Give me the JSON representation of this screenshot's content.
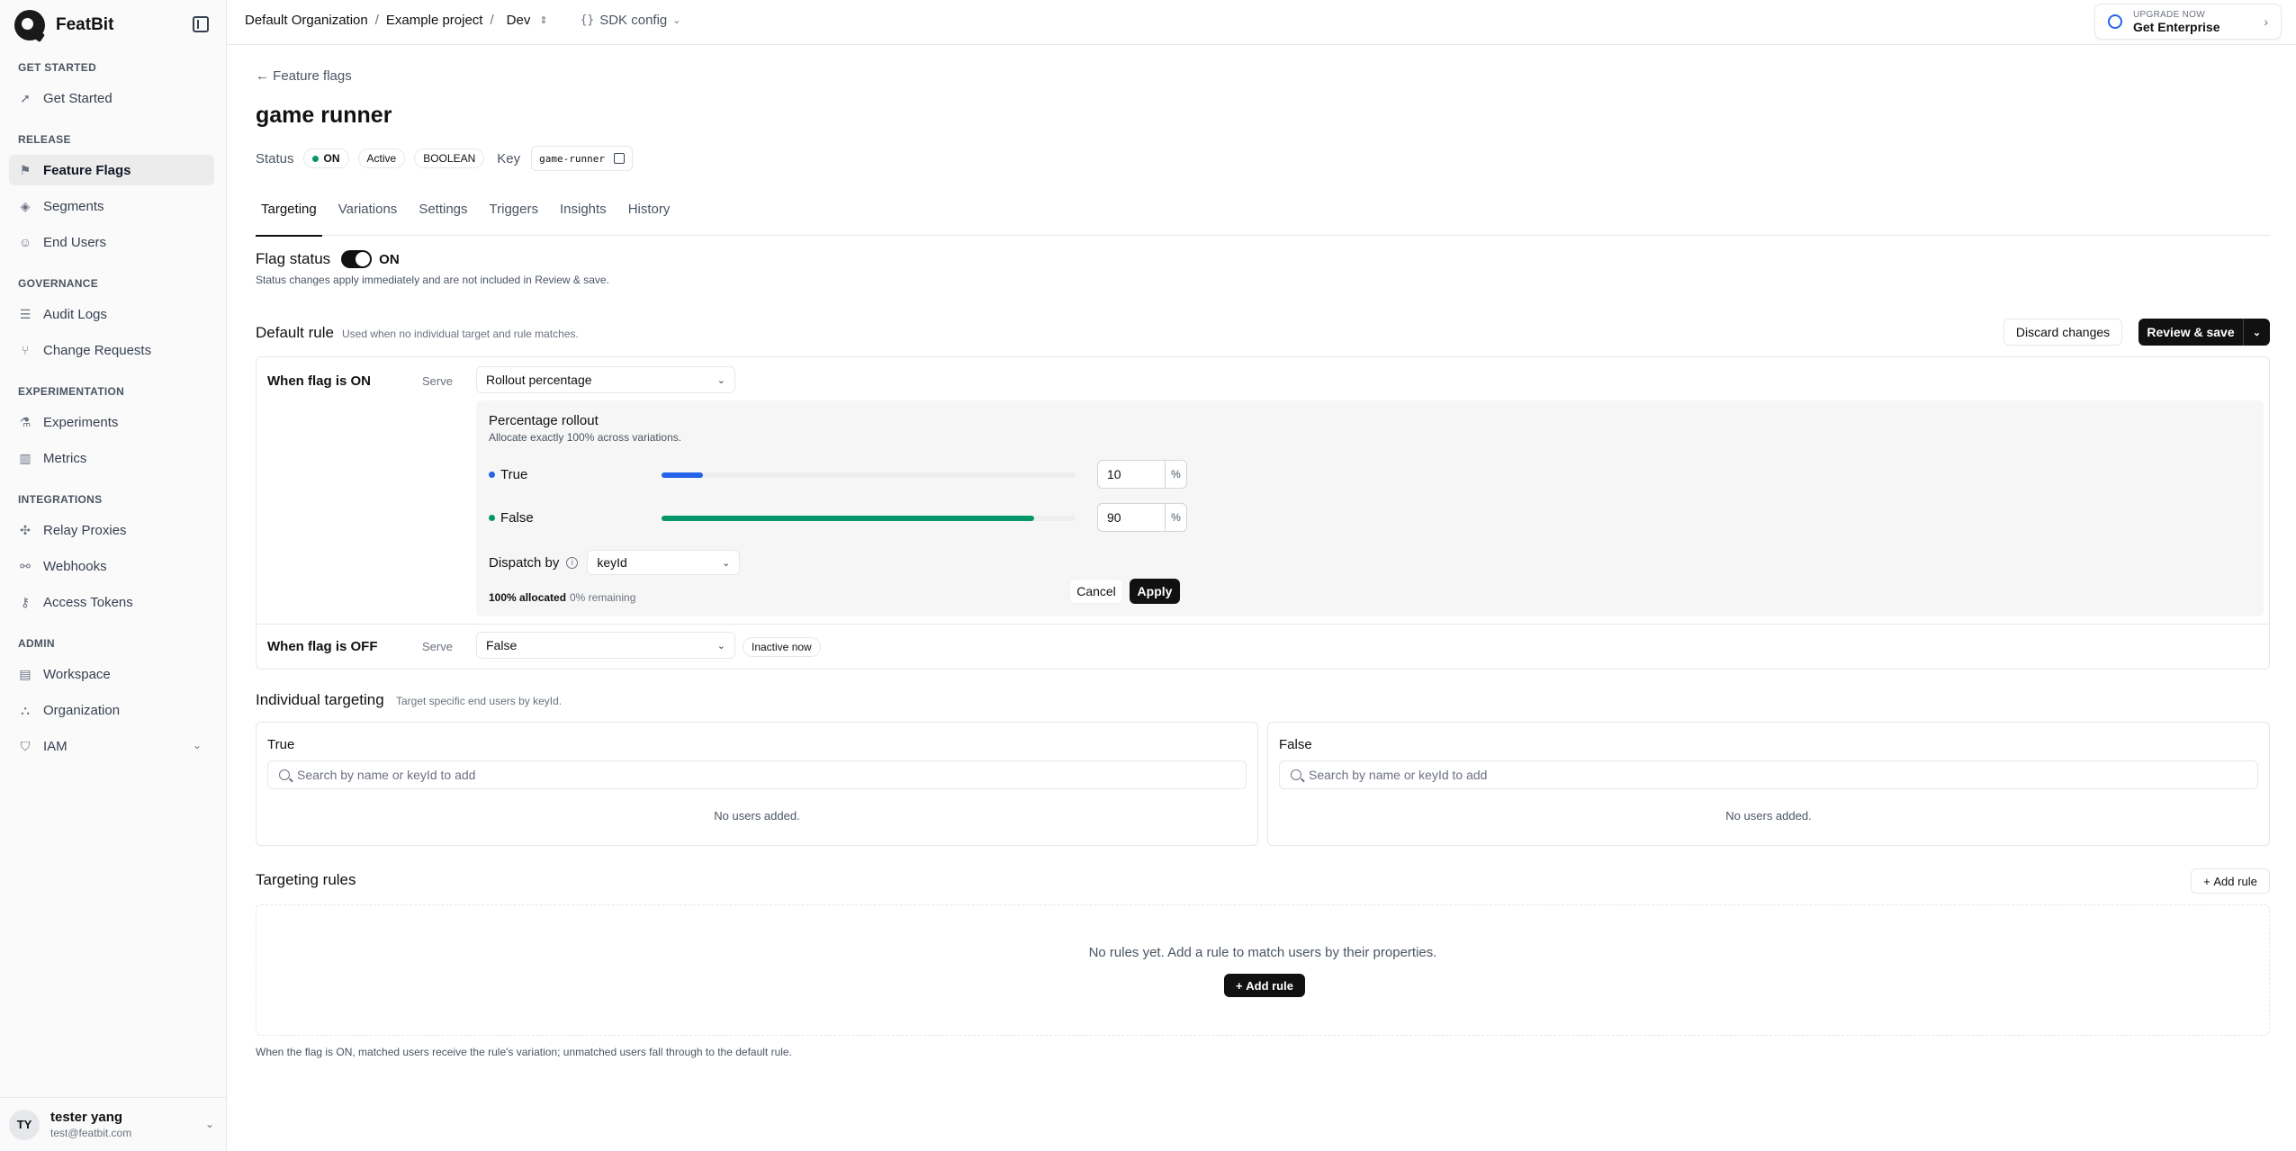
{
  "brand": {
    "name": "FeatBit"
  },
  "sidebar": {
    "sections": [
      {
        "label": "GET STARTED",
        "items": [
          {
            "label": "Get Started",
            "icon": "rocket-icon"
          }
        ]
      },
      {
        "label": "RELEASE",
        "items": [
          {
            "label": "Feature Flags",
            "icon": "flag-icon",
            "active": true
          },
          {
            "label": "Segments",
            "icon": "layers-icon"
          },
          {
            "label": "End Users",
            "icon": "users-icon"
          }
        ]
      },
      {
        "label": "GOVERNANCE",
        "items": [
          {
            "label": "Audit Logs",
            "icon": "list-icon"
          },
          {
            "label": "Change Requests",
            "icon": "git-pull-request-icon"
          }
        ]
      },
      {
        "label": "EXPERIMENTATION",
        "items": [
          {
            "label": "Experiments",
            "icon": "flask-icon"
          },
          {
            "label": "Metrics",
            "icon": "bar-chart-icon"
          }
        ]
      },
      {
        "label": "INTEGRATIONS",
        "items": [
          {
            "label": "Relay Proxies",
            "icon": "relay-icon"
          },
          {
            "label": "Webhooks",
            "icon": "webhook-icon"
          },
          {
            "label": "Access Tokens",
            "icon": "key-icon"
          }
        ]
      },
      {
        "label": "ADMIN",
        "items": [
          {
            "label": "Workspace",
            "icon": "workspace-icon"
          },
          {
            "label": "Organization",
            "icon": "organization-icon"
          },
          {
            "label": "IAM",
            "icon": "shield-icon"
          }
        ]
      }
    ]
  },
  "user": {
    "initials": "TY",
    "name": "tester yang",
    "email": "test@featbit.com"
  },
  "topbar": {
    "org": "Default Organization",
    "project": "Example project",
    "env": "Dev",
    "sdk_config": "SDK config",
    "upgrade_small": "UPGRADE NOW",
    "upgrade_big": "Get Enterprise"
  },
  "flag": {
    "back_label": "Feature flags",
    "name": "game runner",
    "status_label": "Status",
    "status_on": "ON",
    "active": "Active",
    "type": "BOOLEAN",
    "key_label": "Key",
    "key": "game-runner"
  },
  "tabs": [
    "Targeting",
    "Variations",
    "Settings",
    "Triggers",
    "Insights",
    "History"
  ],
  "flag_status": {
    "label": "Flag status",
    "value": "ON",
    "note": "Status changes apply immediately and are not included in Review & save."
  },
  "default_rule": {
    "title": "Default rule",
    "subtitle": "Used when no individual target and rule matches.",
    "discard": "Discard changes",
    "review": "Review & save",
    "on_label": "When flag is ON",
    "serve": "Serve",
    "on_serve_value": "Rollout percentage",
    "rollout_title": "Percentage rollout",
    "rollout_subtitle": "Allocate exactly 100% across variations.",
    "variations": [
      {
        "name": "True",
        "percent": 10,
        "color": "#2563eb"
      },
      {
        "name": "False",
        "percent": 90,
        "color": "#059669"
      }
    ],
    "percent_sign": "%",
    "dispatch_label": "Dispatch by",
    "dispatch_value": "keyId",
    "allocated": "100% allocated",
    "remaining": "0% remaining",
    "cancel": "Cancel",
    "apply": "Apply",
    "off_label": "When flag is OFF",
    "off_serve_value": "False",
    "inactive": "Inactive now"
  },
  "individual_targeting": {
    "title": "Individual targeting",
    "subtitle": "Target specific end users by keyId.",
    "cards": [
      {
        "title": "True",
        "placeholder": "Search by name or keyId to add",
        "empty": "No users added."
      },
      {
        "title": "False",
        "placeholder": "Search by name or keyId to add",
        "empty": "No users added."
      }
    ]
  },
  "targeting_rules": {
    "title": "Targeting rules",
    "add_rule": "Add rule",
    "empty": "No rules yet. Add a rule to match users by their properties.",
    "footnote": "When the flag is ON, matched users receive the rule's variation; unmatched users fall through to the default rule."
  }
}
